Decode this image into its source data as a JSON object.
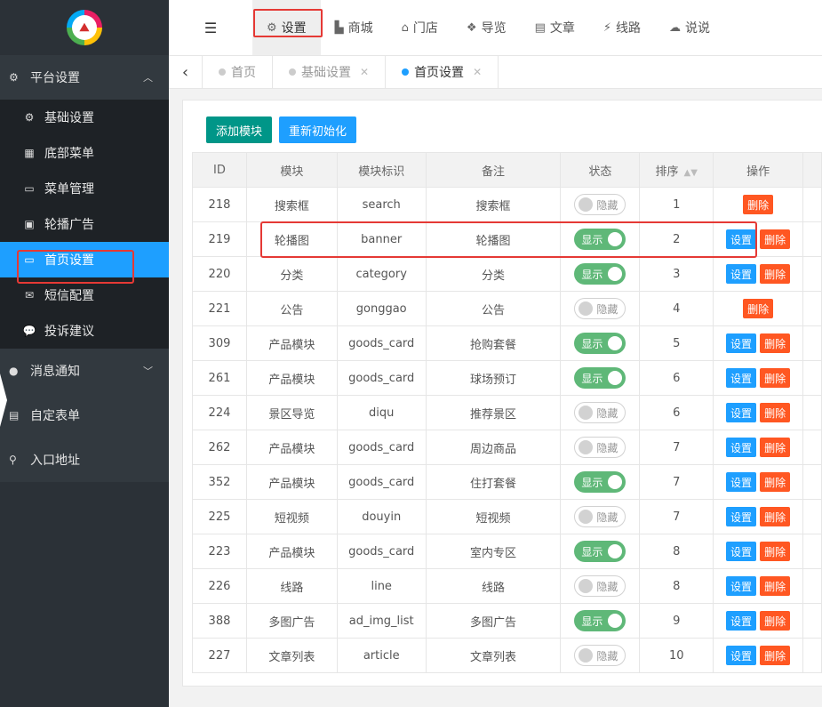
{
  "sidebar": {
    "logo_text": "",
    "groups": [
      {
        "label": "平台设置",
        "icon": "gear-icon",
        "expanded": true
      },
      {
        "label": "消息通知",
        "icon": "chat-bubble-icon",
        "expanded": false
      },
      {
        "label": "自定表单",
        "icon": "form-icon"
      },
      {
        "label": "入口地址",
        "icon": "search-icon"
      }
    ],
    "items": [
      {
        "label": "基础设置",
        "icon": "gear-icon"
      },
      {
        "label": "底部菜单",
        "icon": "grid-icon"
      },
      {
        "label": "菜单管理",
        "icon": "monitor-icon"
      },
      {
        "label": "轮播广告",
        "icon": "image-icon"
      },
      {
        "label": "首页设置",
        "icon": "monitor-icon",
        "active": true
      },
      {
        "label": "短信配置",
        "icon": "mail-icon"
      },
      {
        "label": "投诉建议",
        "icon": "comment-icon"
      }
    ]
  },
  "topbar": {
    "items": [
      {
        "label": "设置",
        "icon": "gears-icon",
        "active": true
      },
      {
        "label": "商城",
        "icon": "shop-icon"
      },
      {
        "label": "门店",
        "icon": "bank-icon"
      },
      {
        "label": "导览",
        "icon": "cubes-icon"
      },
      {
        "label": "文章",
        "icon": "newspaper-icon"
      },
      {
        "label": "线路",
        "icon": "route-icon"
      },
      {
        "label": "说说",
        "icon": "wechat-icon"
      }
    ]
  },
  "tabs": [
    {
      "label": "首页",
      "closable": false,
      "current": false
    },
    {
      "label": "基础设置",
      "closable": true,
      "current": false
    },
    {
      "label": "首页设置",
      "closable": true,
      "current": true
    }
  ],
  "toolbar": {
    "add_label": "添加模块",
    "reinit_label": "重新初始化"
  },
  "table": {
    "headers": [
      "ID",
      "模块",
      "模块标识",
      "备注",
      "状态",
      "排序",
      "操作"
    ],
    "status_on": "显示",
    "status_off": "隐藏",
    "set_label": "设置",
    "delete_label": "删除",
    "rows": [
      {
        "id": "218",
        "module": "搜索框",
        "key": "search",
        "note": "搜索框",
        "on": false,
        "sort": "1",
        "set": false
      },
      {
        "id": "219",
        "module": "轮播图",
        "key": "banner",
        "note": "轮播图",
        "on": true,
        "sort": "2",
        "set": true
      },
      {
        "id": "220",
        "module": "分类",
        "key": "category",
        "note": "分类",
        "on": true,
        "sort": "3",
        "set": true
      },
      {
        "id": "221",
        "module": "公告",
        "key": "gonggao",
        "note": "公告",
        "on": false,
        "sort": "4",
        "set": false
      },
      {
        "id": "309",
        "module": "产品模块",
        "key": "goods_card",
        "note": "抢购套餐",
        "on": true,
        "sort": "5",
        "set": true
      },
      {
        "id": "261",
        "module": "产品模块",
        "key": "goods_card",
        "note": "球场预订",
        "on": true,
        "sort": "6",
        "set": true
      },
      {
        "id": "224",
        "module": "景区导览",
        "key": "diqu",
        "note": "推荐景区",
        "on": false,
        "sort": "6",
        "set": true
      },
      {
        "id": "262",
        "module": "产品模块",
        "key": "goods_card",
        "note": "周边商品",
        "on": false,
        "sort": "7",
        "set": true
      },
      {
        "id": "352",
        "module": "产品模块",
        "key": "goods_card",
        "note": "住打套餐",
        "on": true,
        "sort": "7",
        "set": true
      },
      {
        "id": "225",
        "module": "短视频",
        "key": "douyin",
        "note": "短视频",
        "on": false,
        "sort": "7",
        "set": true
      },
      {
        "id": "223",
        "module": "产品模块",
        "key": "goods_card",
        "note": "室内专区",
        "on": true,
        "sort": "8",
        "set": true
      },
      {
        "id": "226",
        "module": "线路",
        "key": "line",
        "note": "线路",
        "on": false,
        "sort": "8",
        "set": true
      },
      {
        "id": "388",
        "module": "多图广告",
        "key": "ad_img_list",
        "note": "多图广告",
        "on": true,
        "sort": "9",
        "set": true
      },
      {
        "id": "227",
        "module": "文章列表",
        "key": "article",
        "note": "文章列表",
        "on": false,
        "sort": "10",
        "set": true
      }
    ]
  },
  "colors": {
    "accent": "#1e9fff",
    "green": "#009688",
    "switch_on": "#5fb878",
    "danger": "#ff5722",
    "highlight": "#e53935"
  }
}
